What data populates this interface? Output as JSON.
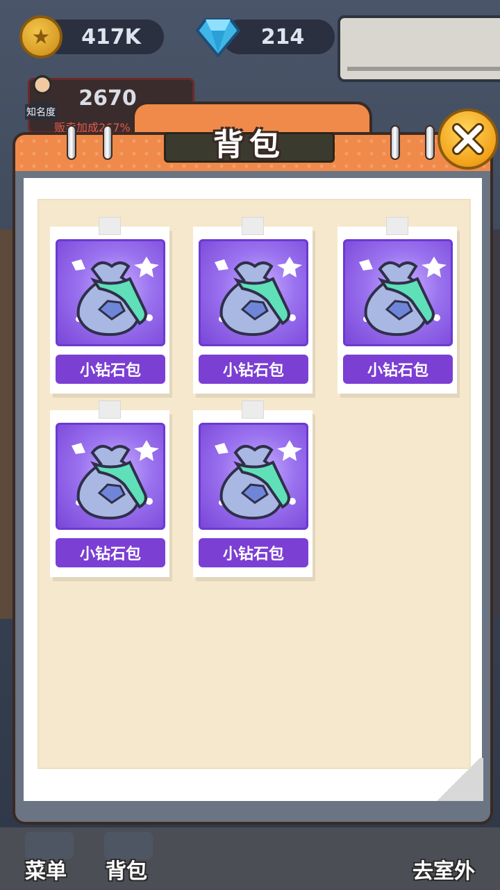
{
  "hud": {
    "coins": "417K",
    "gems": "214",
    "fame_label": "知名度",
    "fame_value": "2670",
    "fame_sub": "贩卖加成267%"
  },
  "panel": {
    "title": "背包"
  },
  "items": [
    {
      "label": "小钻石包"
    },
    {
      "label": "小钻石包"
    },
    {
      "label": "小钻石包"
    },
    {
      "label": "小钻石包"
    },
    {
      "label": "小钻石包"
    }
  ],
  "nav": {
    "menu": "菜单",
    "bag": "背包",
    "outdoor": "去室外"
  },
  "colors": {
    "panel_orange": "#f08a4a",
    "item_purple": "#7b3fd3",
    "paper": "#f6e8cc",
    "close_gold": "#f2a21b"
  }
}
